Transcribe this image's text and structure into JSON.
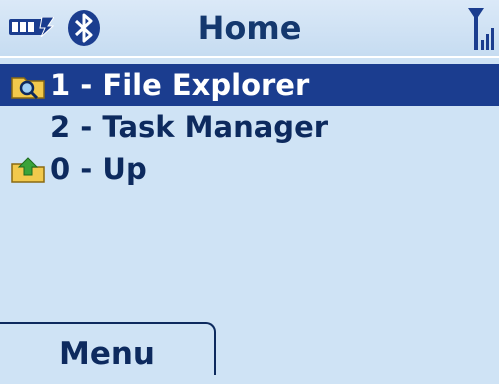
{
  "status_bar": {
    "title": "Home",
    "icons": [
      "battery-icon",
      "bluetooth-icon",
      "signal-strength-icon"
    ]
  },
  "menu_list": {
    "items": [
      {
        "label": "1 - File Explorer",
        "icon": "folder-search-icon",
        "selected": true
      },
      {
        "label": "2 - Task Manager",
        "icon": null,
        "selected": false
      },
      {
        "label": "0 - Up",
        "icon": "folder-up-icon",
        "selected": false
      }
    ]
  },
  "softkeys": {
    "left_label": "Menu"
  },
  "colors": {
    "background": "#cfe3f5",
    "selection": "#1b3d8f",
    "text": "#0d2a5e"
  }
}
